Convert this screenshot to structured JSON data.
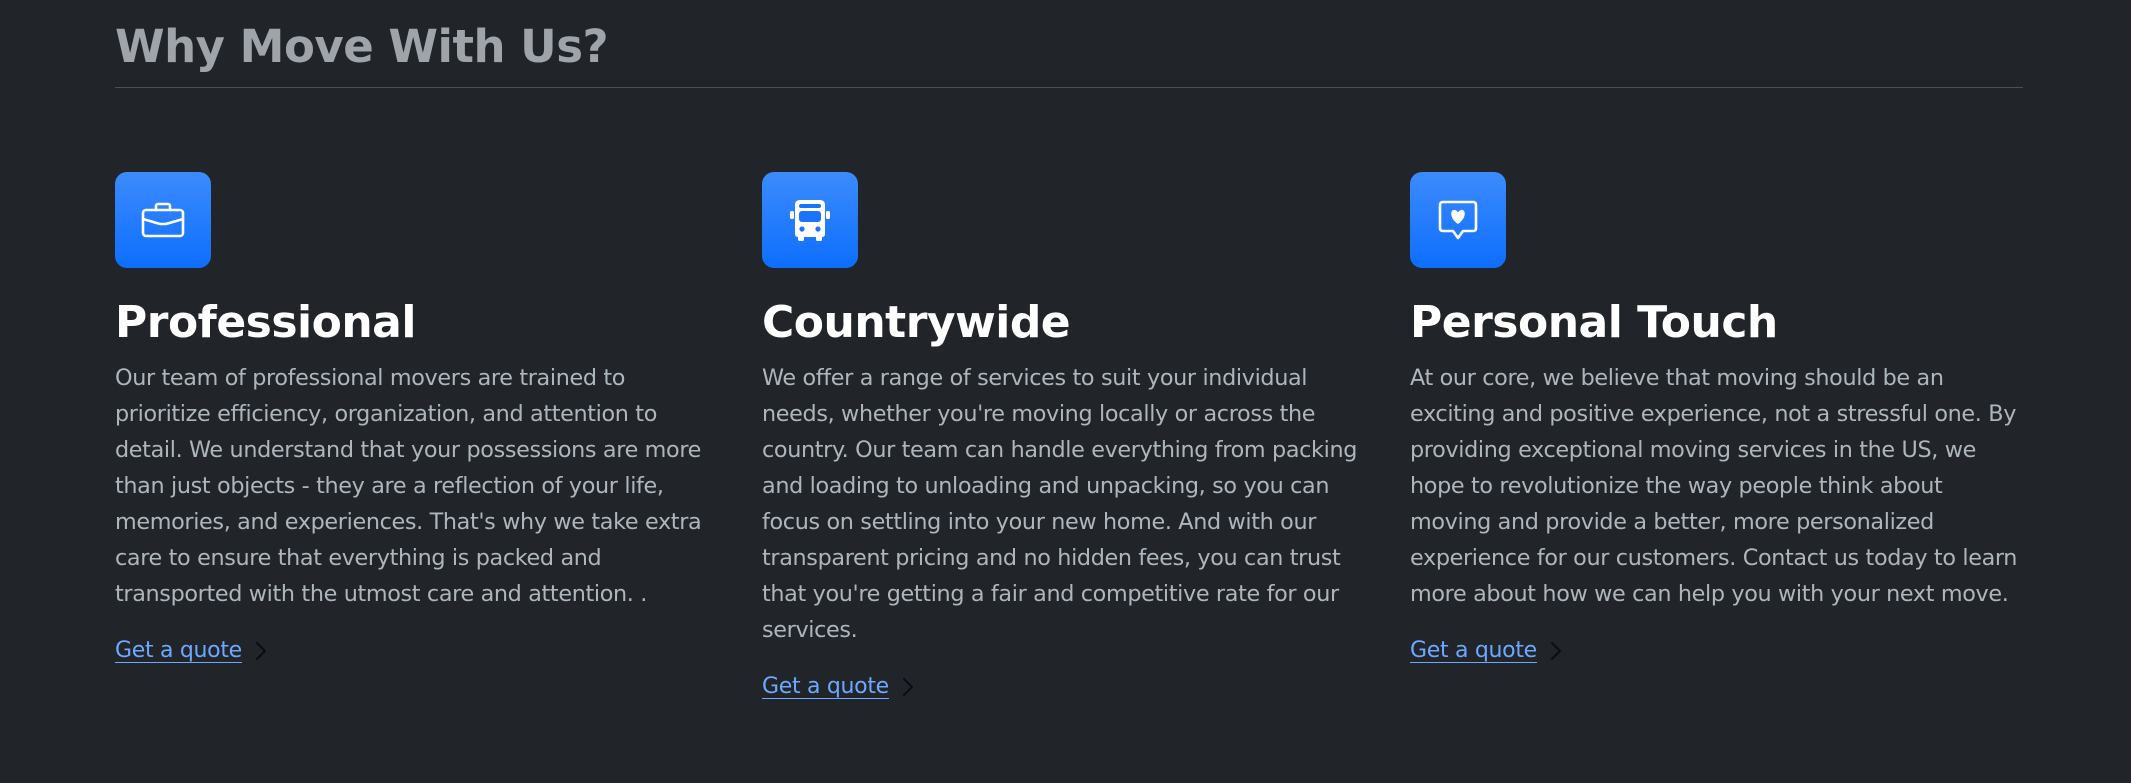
{
  "section": {
    "title": "Why Move With Us?"
  },
  "features": [
    {
      "icon": "briefcase-icon",
      "title": "Professional",
      "text": "Our team of professional movers are trained to prioritize efficiency, organization, and attention to detail. We understand that your possessions are more than just objects - they are a reflection of your life, memories, and experiences. That's why we take extra care to ensure that everything is packed and transported with the utmost care and attention. .",
      "link_label": "Get a quote"
    },
    {
      "icon": "bus-icon",
      "title": "Countrywide",
      "text": "We offer a range of services to suit your individual needs, whether you're moving locally or across the country. Our team can handle everything from packing and loading to unloading and unpacking, so you can focus on settling into your new home. And with our transparent pricing and no hidden fees, you can trust that you're getting a fair and competitive rate for our services.",
      "link_label": "Get a quote"
    },
    {
      "icon": "chat-heart-icon",
      "title": "Personal Touch",
      "text": "At our core, we believe that moving should be an exciting and positive experience, not a stressful one. By providing exceptional moving services in the US, we hope to revolutionize the way people think about moving and provide a better, more personalized experience for our customers. Contact us today to learn more about how we can help you with your next move.",
      "link_label": "Get a quote"
    }
  ],
  "colors": {
    "background": "#212529",
    "accent": "#0d6efd",
    "link": "#6ea8fe",
    "heading": "#ffffff",
    "body_text": "#adb5bd"
  }
}
